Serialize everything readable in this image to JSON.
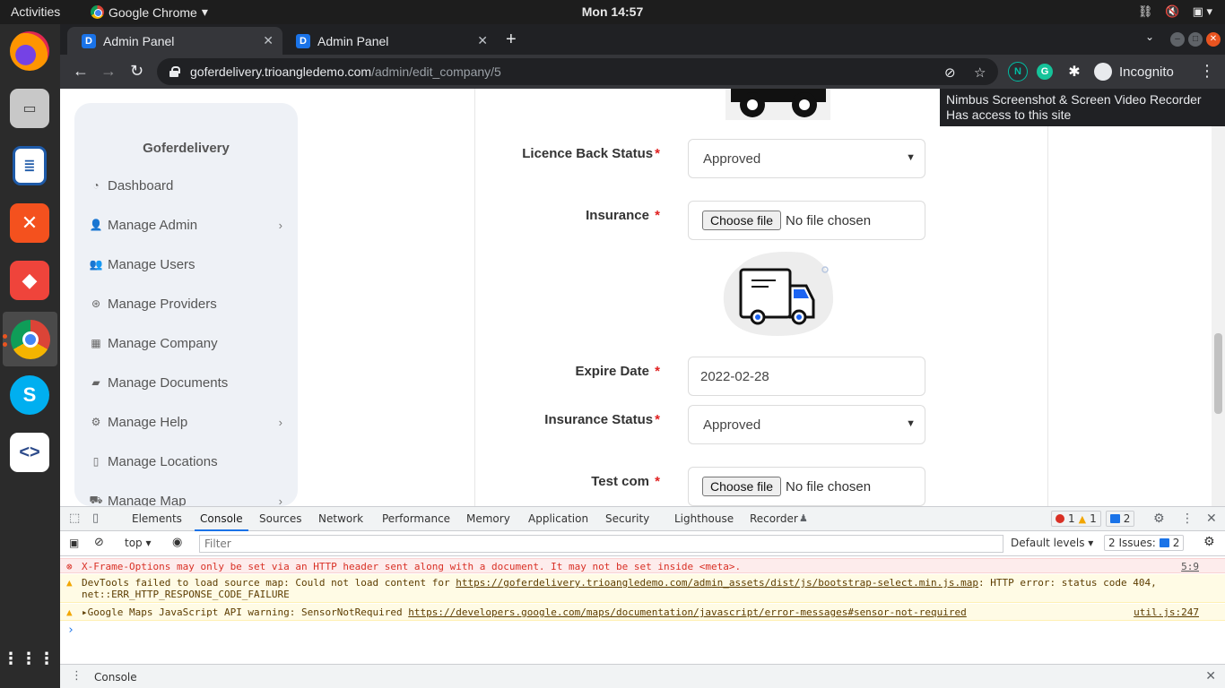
{
  "system": {
    "activities": "Activities",
    "app_name": "Google Chrome",
    "clock": "Mon 14:57"
  },
  "browser": {
    "tabs": [
      {
        "title": "Admin Panel",
        "active": true
      },
      {
        "title": "Admin Panel",
        "active": false
      }
    ],
    "url_host": "goferdelivery.trioangledemo.com",
    "url_path": "/admin/edit_company/5",
    "profile_label": "Incognito",
    "tooltip_line1": "Nimbus Screenshot & Screen Video Recorder",
    "tooltip_line2": "Has access to this site"
  },
  "sidebar": {
    "brand": "Goferdelivery",
    "items": [
      {
        "label": "Dashboard",
        "icon": "dashboard-icon",
        "has_submenu": false
      },
      {
        "label": "Manage Admin",
        "icon": "user-plus-icon",
        "has_submenu": true
      },
      {
        "label": "Manage Users",
        "icon": "users-icon",
        "has_submenu": false
      },
      {
        "label": "Manage Providers",
        "icon": "providers-icon",
        "has_submenu": false
      },
      {
        "label": "Manage Company",
        "icon": "building-icon",
        "has_submenu": false
      },
      {
        "label": "Manage Documents",
        "icon": "book-icon",
        "has_submenu": false
      },
      {
        "label": "Manage Help",
        "icon": "cogs-icon",
        "has_submenu": true
      },
      {
        "label": "Manage Locations",
        "icon": "map-icon",
        "has_submenu": false
      },
      {
        "label": "Manage Map",
        "icon": "taxi-icon",
        "has_submenu": true
      }
    ]
  },
  "form": {
    "licence_back_status": {
      "label": "Licence Back Status",
      "value": "Approved"
    },
    "insurance": {
      "label": "Insurance",
      "button": "Choose file",
      "file_text": "No file chosen"
    },
    "expire_date": {
      "label": "Expire Date",
      "value": "2022-02-28"
    },
    "insurance_status": {
      "label": "Insurance Status",
      "value": "Approved"
    },
    "test_com": {
      "label": "Test com",
      "button": "Choose file",
      "file_text": "No file chosen"
    },
    "required_mark": "*"
  },
  "devtools": {
    "tabs": [
      "Elements",
      "Console",
      "Sources",
      "Network",
      "Performance",
      "Memory",
      "Application",
      "Security",
      "Lighthouse",
      "Recorder"
    ],
    "error_count": "1",
    "warning_count": "1",
    "message_count": "2",
    "context": "top",
    "filter_placeholder": "Filter",
    "levels": "Default levels",
    "issues": "2 Issues:",
    "issues_count": "2",
    "messages": [
      {
        "level": "error",
        "text": "X-Frame-Options may only be set via an HTTP header sent along with a document. It may not be set inside <meta>.",
        "source": "5:9"
      },
      {
        "level": "warning",
        "text_before": "DevTools failed to load source map: Could not load content for ",
        "link": "https://goferdelivery.trioangledemo.com/admin_assets/dist/js/bootstrap-select.min.js.map",
        "text_after": ": HTTP error: status code 404, net::ERR_HTTP_RESPONSE_CODE_FAILURE"
      },
      {
        "level": "warning",
        "text_before": "Google Maps JavaScript API warning: SensorNotRequired ",
        "link": "https://developers.google.com/maps/documentation/javascript/error-messages#sensor-not-required",
        "source": "util.js:247"
      }
    ],
    "drawer_tab": "Console"
  },
  "colors": {
    "accent": "#1a73e8",
    "required": "#e02020",
    "sidebar_bg": "#eef1f6",
    "error": "#d93025"
  }
}
